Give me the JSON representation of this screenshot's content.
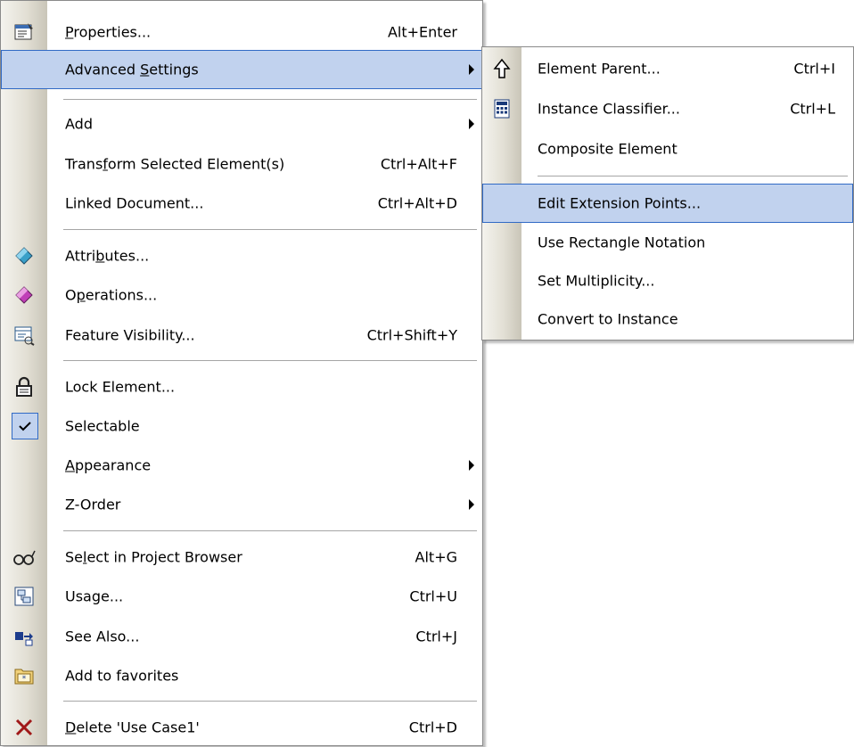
{
  "main_menu": {
    "items": [
      {
        "label_pre": "",
        "label_ul": "P",
        "label_post": "roperties...",
        "shortcut": "Alt+Enter",
        "icon": "properties-icon"
      },
      {
        "label_pre": "Advanced ",
        "label_ul": "S",
        "label_post": "ettings",
        "shortcut": "",
        "submenu": true
      },
      {
        "label_pre": "Add",
        "label_ul": "",
        "label_post": "",
        "shortcut": "",
        "submenu": true
      },
      {
        "label_pre": "Trans",
        "label_ul": "f",
        "label_post": "orm Selected Element(s)",
        "shortcut": "Ctrl+Alt+F"
      },
      {
        "label_pre": "Linked Document...",
        "label_ul": "",
        "label_post": "",
        "shortcut": "Ctrl+Alt+D"
      },
      {
        "label_pre": "Attri",
        "label_ul": "b",
        "label_post": "utes...",
        "shortcut": "",
        "icon": "attributes-icon"
      },
      {
        "label_pre": "O",
        "label_ul": "p",
        "label_post": "erations...",
        "shortcut": "",
        "icon": "operations-icon"
      },
      {
        "label_pre": "Feature Visibility...",
        "label_ul": "",
        "label_post": "",
        "shortcut": "Ctrl+Shift+Y",
        "icon": "feature-visibility-icon"
      },
      {
        "label_pre": "Lock Element...",
        "label_ul": "",
        "label_post": "",
        "shortcut": "",
        "icon": "lock-icon"
      },
      {
        "label_pre": "Selectable",
        "label_ul": "",
        "label_post": "",
        "shortcut": "",
        "icon": "checkmark-icon"
      },
      {
        "label_pre": "",
        "label_ul": "A",
        "label_post": "ppearance",
        "shortcut": "",
        "submenu": true
      },
      {
        "label_pre": "Z-Order",
        "label_ul": "",
        "label_post": "",
        "shortcut": "",
        "submenu": true
      },
      {
        "label_pre": "Se",
        "label_ul": "l",
        "label_post": "ect in Project Browser",
        "shortcut": "Alt+G",
        "icon": "glasses-icon"
      },
      {
        "label_pre": "Usage...",
        "label_ul": "",
        "label_post": "",
        "shortcut": "Ctrl+U",
        "icon": "usage-icon"
      },
      {
        "label_pre": "See Also...",
        "label_ul": "",
        "label_post": "",
        "shortcut": "Ctrl+J",
        "icon": "see-also-icon"
      },
      {
        "label_pre": "Add to favorites",
        "label_ul": "",
        "label_post": "",
        "shortcut": "",
        "icon": "favorites-icon"
      },
      {
        "label_pre": "",
        "label_ul": "D",
        "label_post": "elete 'Use Case1'",
        "shortcut": "Ctrl+D",
        "icon": "delete-icon"
      }
    ]
  },
  "sub_menu": {
    "items": [
      {
        "label": "Element Parent...",
        "shortcut": "Ctrl+I",
        "icon": "element-parent-icon"
      },
      {
        "label": "Instance Classifier...",
        "shortcut": "Ctrl+L",
        "icon": "calculator-icon"
      },
      {
        "label": "Composite Element",
        "shortcut": ""
      },
      {
        "label": "Edit Extension Points...",
        "shortcut": ""
      },
      {
        "label": "Use Rectangle Notation",
        "shortcut": ""
      },
      {
        "label": "Set Multiplicity...",
        "shortcut": ""
      },
      {
        "label": "Convert to Instance",
        "shortcut": ""
      }
    ]
  },
  "colors": {
    "highlight": "#c1d2ee",
    "highlight_border": "#316ac5",
    "separator": "#a6a6a6"
  }
}
